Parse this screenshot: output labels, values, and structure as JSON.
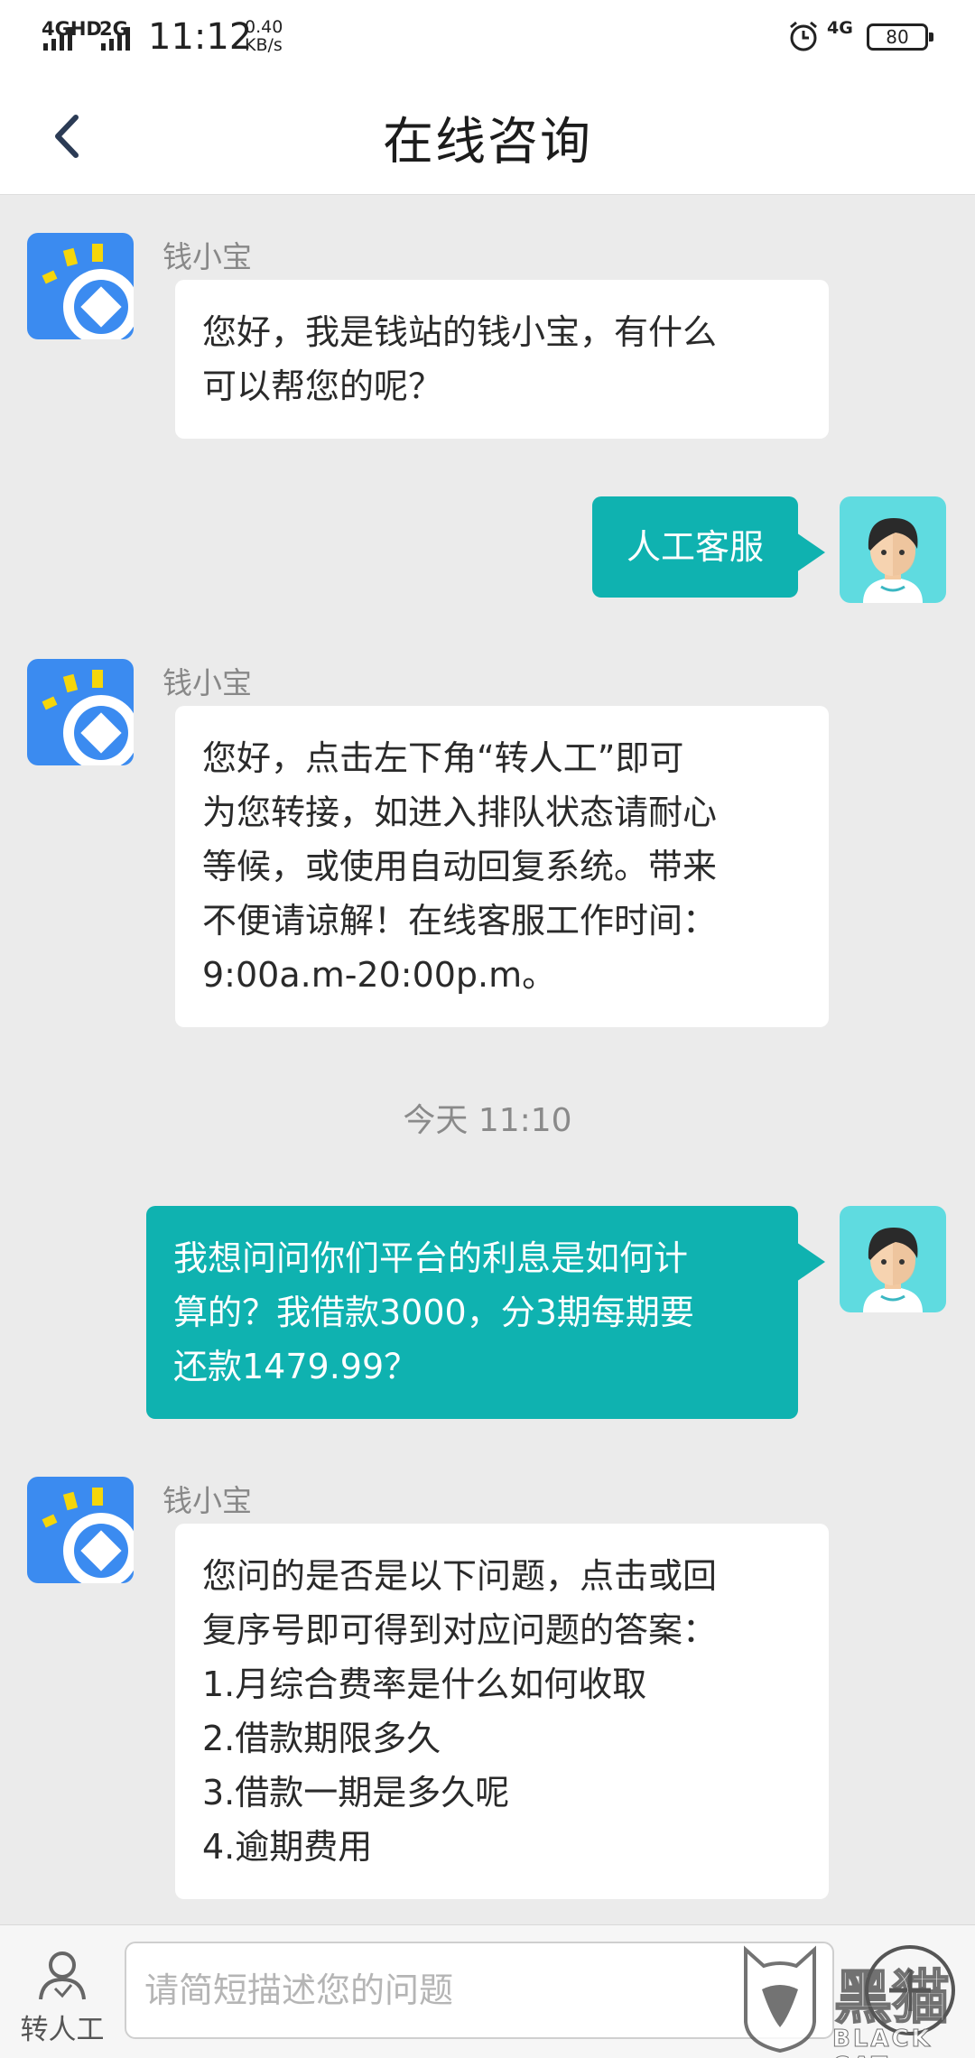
{
  "status_bar": {
    "network1": "4GHD",
    "network2": "2G",
    "time": "11:12",
    "speed_value": "0.40",
    "speed_unit": "KB/s",
    "network3": "4G",
    "battery": "80"
  },
  "header": {
    "title": "在线咨询"
  },
  "messages": [
    {
      "sender": "钱小宝",
      "text": "您好，我是钱站的钱小宝，有什么\n可以帮您的呢？"
    },
    {
      "text": "人工客服"
    },
    {
      "sender": "钱小宝",
      "text": "您好，点击左下角“转人工”即可\n为您转接，如进入排队状态请耐心\n等候，或使用自动回复系统。带来\n不便请谅解！在线客服工作时间：\n9:00a.m-20:00p.m。"
    },
    {
      "text": "我想问问你们平台的利息是如何计\n算的？我借款3000，分3期每期要\n还款1479.99？"
    },
    {
      "sender": "钱小宝",
      "text": "您问的是否是以下问题，点击或回\n复序号即可得到对应问题的答案：\n1.月综合费率是什么如何收取\n2.借款期限多久\n3.借款一期是多久呢\n4.逾期费用"
    }
  ],
  "timestamp": "今天 11:10",
  "bottom_bar": {
    "transfer_label": "转人工",
    "input_placeholder": "请简短描述您的问题"
  },
  "watermark": {
    "main": "黑猫",
    "sub": "BLACK CAT"
  },
  "colors": {
    "accent": "#0fb2b0",
    "bot_avatar": "#3b8bf0",
    "bot_rays": "#f5d60a",
    "user_avatar_bg": "#5fdbe0"
  }
}
